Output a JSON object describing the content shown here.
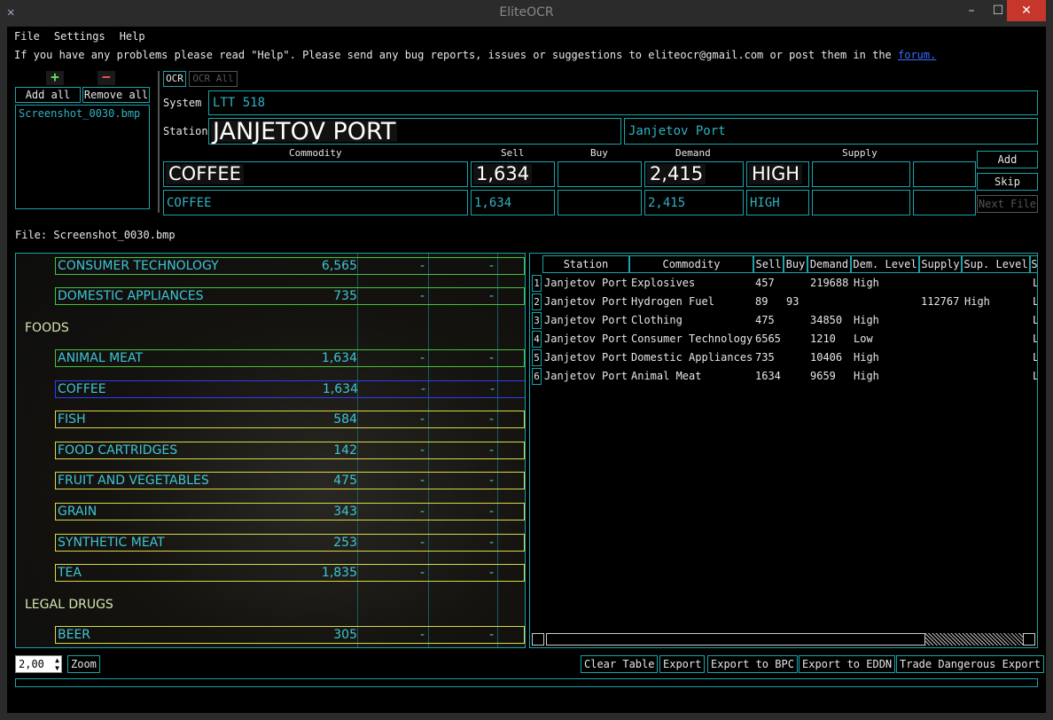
{
  "window": {
    "title": "EliteOCR",
    "min": "–",
    "max": "☐",
    "close": "✕"
  },
  "menu": [
    "File",
    "Settings",
    "Help"
  ],
  "notice": {
    "text": "If you have any problems please read \"Help\". Please send any bug reports, issues or suggestions to eliteocr@gmail.com or post them in the ",
    "link": "forum."
  },
  "files": {
    "add_all": "Add all",
    "remove_all": "Remove all",
    "items": [
      "Screenshot_0030.bmp"
    ]
  },
  "ocr": {
    "ocr_btn": "OCR",
    "ocr_all_btn": "OCR All",
    "system_label": "System",
    "system_value": "LTT 518",
    "station_label": "Station",
    "station_ocr": "JANJETOV PORT",
    "station_value": "Janjetov Port",
    "headers": {
      "commodity": "Commodity",
      "sell": "Sell",
      "buy": "Buy",
      "demand": "Demand",
      "supply": "Supply"
    },
    "img": {
      "commodity": "COFFEE",
      "sell": "1,634",
      "demand": "2,415",
      "demand_level": "HIGH"
    },
    "fields": {
      "commodity": "COFFEE",
      "sell": "1,634",
      "demand": "2,415",
      "demand_level": "HIGH"
    },
    "add": "Add",
    "skip": "Skip",
    "next_file": "Next File"
  },
  "file_label": "File: Screenshot_0030.bmp",
  "game": {
    "rows": [
      {
        "name": "CONSUMER TECHNOLOGY",
        "val": "6,565",
        "d1": "-",
        "d2": "-",
        "style": "green"
      },
      {
        "name": "DOMESTIC APPLIANCES",
        "val": "735",
        "d1": "-",
        "d2": "-",
        "style": "green"
      },
      {
        "name": "ANIMAL MEAT",
        "val": "1,634",
        "d1": "-",
        "d2": "-",
        "style": "green"
      },
      {
        "name": "COFFEE",
        "val": "1,634",
        "d1": "-",
        "d2": "-",
        "style": "blue"
      },
      {
        "name": "FISH",
        "val": "584",
        "d1": "-",
        "d2": "-",
        "style": "yellow"
      },
      {
        "name": "FOOD CARTRIDGES",
        "val": "142",
        "d1": "-",
        "d2": "-",
        "style": "yellow"
      },
      {
        "name": "FRUIT AND VEGETABLES",
        "val": "475",
        "d1": "-",
        "d2": "-",
        "style": "yellow"
      },
      {
        "name": "GRAIN",
        "val": "343",
        "d1": "-",
        "d2": "-",
        "style": "yellow"
      },
      {
        "name": "SYNTHETIC MEAT",
        "val": "253",
        "d1": "-",
        "d2": "-",
        "style": "yellow"
      },
      {
        "name": "TEA",
        "val": "1,835",
        "d1": "-",
        "d2": "-",
        "style": "yellow"
      },
      {
        "name": "BEER",
        "val": "305",
        "d1": "-",
        "d2": "-",
        "style": "yellow"
      }
    ],
    "sections": [
      "FOODS",
      "LEGAL DRUGS"
    ]
  },
  "table": {
    "headers": [
      "Station",
      "Commodity",
      "Sell",
      "Buy",
      "Demand",
      "Dem. Level",
      "Supply",
      "Sup. Level",
      "S"
    ],
    "rows": [
      {
        "n": "1",
        "station": "Janjetov Port",
        "commodity": "Explosives",
        "sell": "457",
        "buy": "",
        "demand": "219688",
        "dem_level": "High",
        "supply": "",
        "sup_level": "",
        "tail": "L"
      },
      {
        "n": "2",
        "station": "Janjetov Port",
        "commodity": "Hydrogen Fuel",
        "sell": "89",
        "buy": "93",
        "demand": "",
        "dem_level": "",
        "supply": "112767",
        "sup_level": "High",
        "tail": "L"
      },
      {
        "n": "3",
        "station": "Janjetov Port",
        "commodity": "Clothing",
        "sell": "475",
        "buy": "",
        "demand": "34850",
        "dem_level": "High",
        "supply": "",
        "sup_level": "",
        "tail": "L"
      },
      {
        "n": "4",
        "station": "Janjetov Port",
        "commodity": "Consumer Technology",
        "sell": "6565",
        "buy": "",
        "demand": "1210",
        "dem_level": "Low",
        "supply": "",
        "sup_level": "",
        "tail": "L"
      },
      {
        "n": "5",
        "station": "Janjetov Port",
        "commodity": "Domestic Appliances",
        "sell": "735",
        "buy": "",
        "demand": "10406",
        "dem_level": "High",
        "supply": "",
        "sup_level": "",
        "tail": "L"
      },
      {
        "n": "6",
        "station": "Janjetov Port",
        "commodity": "Animal Meat",
        "sell": "1634",
        "buy": "",
        "demand": "9659",
        "dem_level": "High",
        "supply": "",
        "sup_level": "",
        "tail": "L"
      }
    ]
  },
  "bottom": {
    "zoom_value": "2,00",
    "zoom_btn": "Zoom",
    "clear": "Clear Table",
    "export": "Export",
    "export_bpc": "Export to BPC",
    "export_eddn": "Export to EDDN",
    "trade": "Trade Dangerous Export"
  }
}
